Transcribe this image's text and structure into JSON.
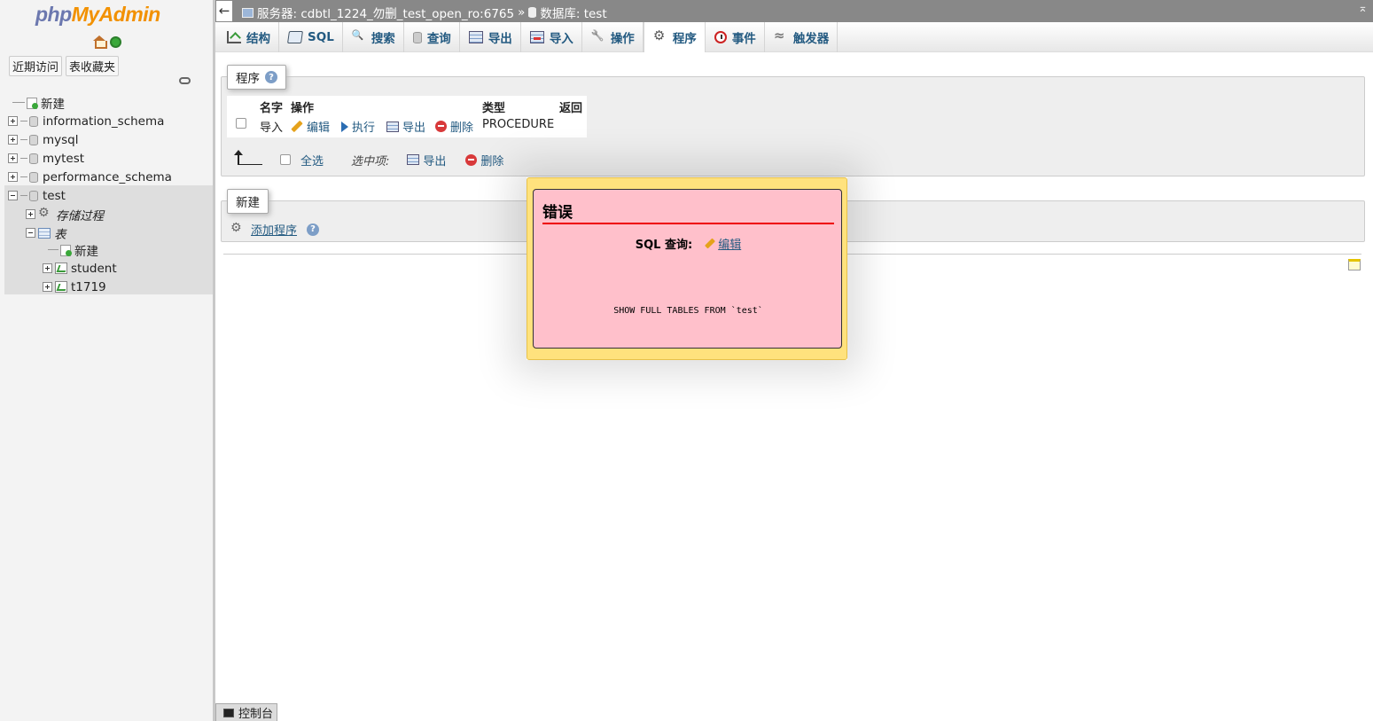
{
  "nav": {
    "logo_php": "php",
    "logo_myadmin": "MyAdmin",
    "tab_recent": "近期访问",
    "tab_favorites": "表收藏夹",
    "tree": {
      "new": "新建",
      "dbs": [
        "information_schema",
        "mysql",
        "mytest",
        "performance_schema"
      ],
      "current_db": "test",
      "routines": "存储过程",
      "tables": "表",
      "tables_new": "新建",
      "table_items": [
        "student",
        "t1719"
      ]
    }
  },
  "topbar": {
    "back": "←",
    "server_label": "服务器: cdbtl_1224_勿删_test_open_ro:6765",
    "sep": "»",
    "db_label": "数据库: test",
    "collapse": "⌅"
  },
  "tabs": [
    {
      "label": "结构",
      "icon": "structure-icon"
    },
    {
      "label": "SQL",
      "icon": "sql-icon"
    },
    {
      "label": "搜索",
      "icon": "search-icon"
    },
    {
      "label": "查询",
      "icon": "query-icon"
    },
    {
      "label": "导出",
      "icon": "export-icon"
    },
    {
      "label": "导入",
      "icon": "import-icon"
    },
    {
      "label": "操作",
      "icon": "operations-icon"
    },
    {
      "label": "程序",
      "icon": "routines-icon",
      "active": true
    },
    {
      "label": "事件",
      "icon": "events-icon"
    },
    {
      "label": "触发器",
      "icon": "triggers-icon"
    }
  ],
  "routines": {
    "legend": "程序",
    "headers": {
      "name": "名字",
      "action": "操作",
      "type": "类型",
      "returns": "返回"
    },
    "row": {
      "name": "导入",
      "edit": "编辑",
      "execute": "执行",
      "export": "导出",
      "delete": "删除",
      "type": "PROCEDURE",
      "returns": ""
    },
    "check_all": "全选",
    "with_selected": "选中项:",
    "bulk_export": "导出",
    "bulk_delete": "删除"
  },
  "new_section": {
    "legend": "新建",
    "add_routine": "添加程序"
  },
  "error_dialog": {
    "title": "错误",
    "sql_label": "SQL 查询:",
    "edit": "编辑",
    "query": "SHOW FULL TABLES FROM `test`"
  },
  "console": {
    "label": "控制台"
  },
  "colors": {
    "link": "#235a81",
    "error_bg": "#ffc0cb",
    "dialog_bg": "#ffe27d",
    "error_rule": "#e00000"
  }
}
